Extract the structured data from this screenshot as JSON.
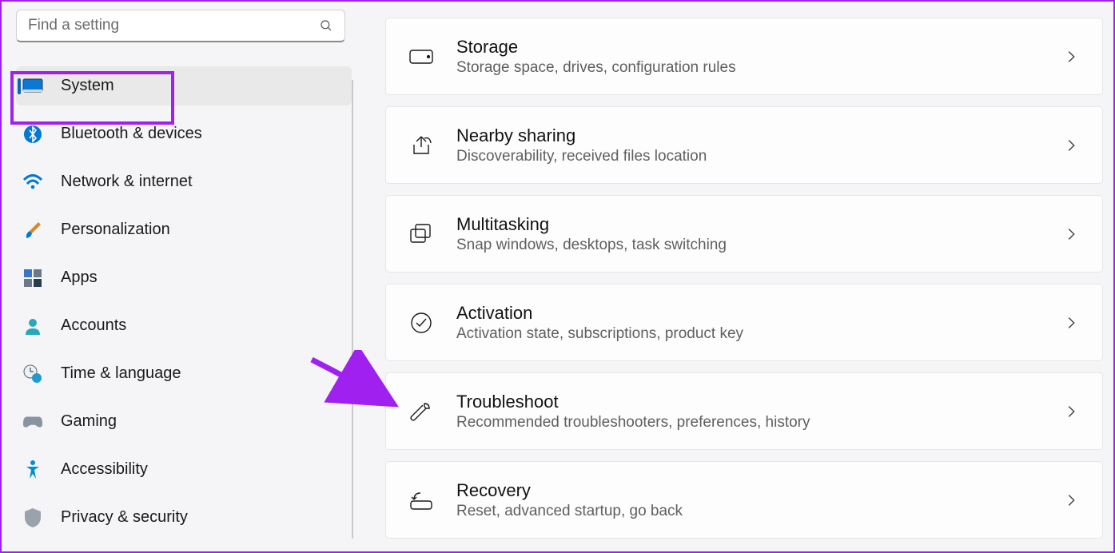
{
  "search": {
    "placeholder": "Find a setting"
  },
  "sidebar": {
    "items": [
      {
        "label": "System"
      },
      {
        "label": "Bluetooth & devices"
      },
      {
        "label": "Network & internet"
      },
      {
        "label": "Personalization"
      },
      {
        "label": "Apps"
      },
      {
        "label": "Accounts"
      },
      {
        "label": "Time & language"
      },
      {
        "label": "Gaming"
      },
      {
        "label": "Accessibility"
      },
      {
        "label": "Privacy & security"
      }
    ]
  },
  "main": {
    "cards": [
      {
        "title": "Storage",
        "sub": "Storage space, drives, configuration rules"
      },
      {
        "title": "Nearby sharing",
        "sub": "Discoverability, received files location"
      },
      {
        "title": "Multitasking",
        "sub": "Snap windows, desktops, task switching"
      },
      {
        "title": "Activation",
        "sub": "Activation state, subscriptions, product key"
      },
      {
        "title": "Troubleshoot",
        "sub": "Recommended troubleshooters, preferences, history"
      },
      {
        "title": "Recovery",
        "sub": "Reset, advanced startup, go back"
      }
    ]
  }
}
